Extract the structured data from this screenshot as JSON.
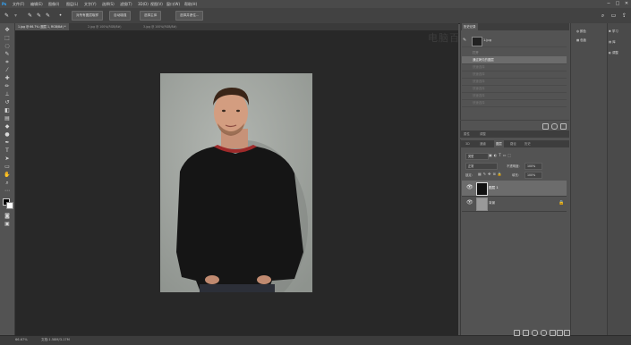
{
  "menubar": {
    "logo": "Ps",
    "items": [
      "文件(F)",
      "编辑(E)",
      "图像(I)",
      "图层(L)",
      "文字(Y)",
      "选择(S)",
      "滤镜(T)",
      "3D(D)",
      "视图(V)",
      "窗口(W)",
      "帮助(H)"
    ],
    "minimize": "─",
    "maximize": "□",
    "close": "✕"
  },
  "options": {
    "btn_sample_all": "对所有图层取样",
    "btn_auto_enhance": "自动增强",
    "btn_select_subject": "选择主体",
    "btn_select_mask": "选择并遮住..."
  },
  "tabs": [
    {
      "label": "1.jpg @ 66.7% (图层 1, RGB/8#) *",
      "active": true
    },
    {
      "label": "2.jpg @ 100%(RGB/8#)",
      "active": false
    },
    {
      "label": "3.jpg @ 100%(RGB/8#)",
      "active": false
    }
  ],
  "watermark": "电脑百事网",
  "status": {
    "zoom": "66.67%",
    "doc_info": "文档:1.58M/3.17M"
  },
  "history": {
    "tab": "历史记录",
    "snapshot": "1.jpg",
    "rows": [
      {
        "label": "打开",
        "active": false
      },
      {
        "label": "通过拷贝的图层",
        "active": true
      },
      {
        "label": "快速选择",
        "active": false
      },
      {
        "label": "快速选择",
        "active": false
      },
      {
        "label": "快速选择",
        "active": false
      },
      {
        "label": "快速选择",
        "active": false
      },
      {
        "label": "快速选择",
        "active": false
      },
      {
        "label": "快速选择",
        "active": false
      }
    ]
  },
  "panels_mid": {
    "tabs": [
      "属性",
      "调整"
    ]
  },
  "layers": {
    "tabs": [
      "3D",
      "通道",
      "图层",
      "路径",
      "历史"
    ],
    "filter": "类型",
    "blend_mode": "正常",
    "opacity_label": "不透明度:",
    "opacity": "100%",
    "lock_label": "锁定:",
    "fill_label": "填充:",
    "fill": "100%",
    "items": [
      {
        "name": "图层 1",
        "active": true
      },
      {
        "name": "背景",
        "active": false
      }
    ]
  },
  "right_dock": {
    "color": "颜色",
    "swatches": "色板",
    "learn": "学习",
    "libraries": "库",
    "adjust": "调整"
  },
  "colors": {
    "accent": "#6c6c6c",
    "canvas": "#282828",
    "panel": "#535353"
  }
}
